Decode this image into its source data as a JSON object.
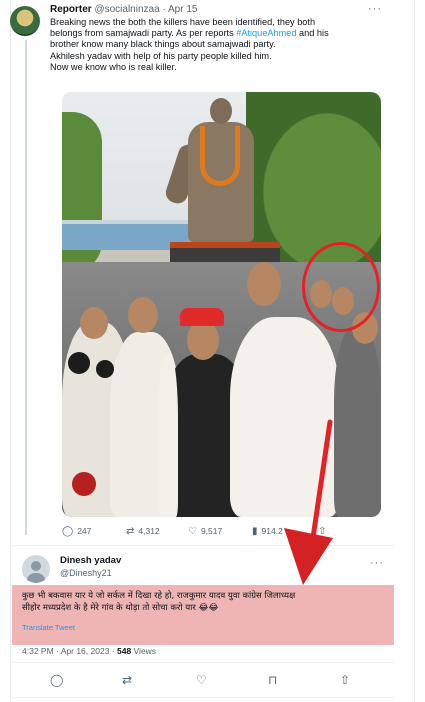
{
  "original_tweet": {
    "display_name": "Reporter",
    "handle": "@socialninzaa",
    "separator": "·",
    "date": "Apr 15",
    "text_lines": [
      "Breaking news the both the killers have been identified, they both",
      "belongs from samajwadi party. As per reports ",
      "brother know many black things about samajwadi party.",
      "Akhilesh yadav with help of his party people killed him.",
      "Now we know who is real killer."
    ],
    "hashtag": "#AtiqueAhmed",
    "after_hashtag": " and his",
    "more_label": "···",
    "stats": {
      "replies": "247",
      "retweets": "4,312",
      "likes": "9,517",
      "views": "914.2"
    }
  },
  "reply": {
    "display_name": "Dinesh yadav",
    "handle": "@Dineshy21",
    "more_label": "···",
    "text_lines": [
      "कुछ भी बकवास यार ये जो सर्कल में दिखा रहे हो, राजकुमार यादव युवा कांग्रेस जिलाध्यक्ष",
      "सीहोर मध्यप्रदेश के है मेरे गांव के थोड़ा तो सोचा करो यार 😂😂"
    ],
    "translate_label": "Translate Tweet",
    "timestamp": "4:32 PM · Apr 16, 2023 · ",
    "views_count": "548",
    "views_label": " Views"
  },
  "icons": {
    "reply": "reply-icon",
    "retweet": "retweet-icon",
    "like": "like-icon",
    "views": "views-icon",
    "share": "share-icon",
    "bookmark": "bookmark-icon"
  },
  "colors": {
    "accent": "#1d9bf0",
    "highlight": "#e17878",
    "annotation_red": "#e52125"
  }
}
